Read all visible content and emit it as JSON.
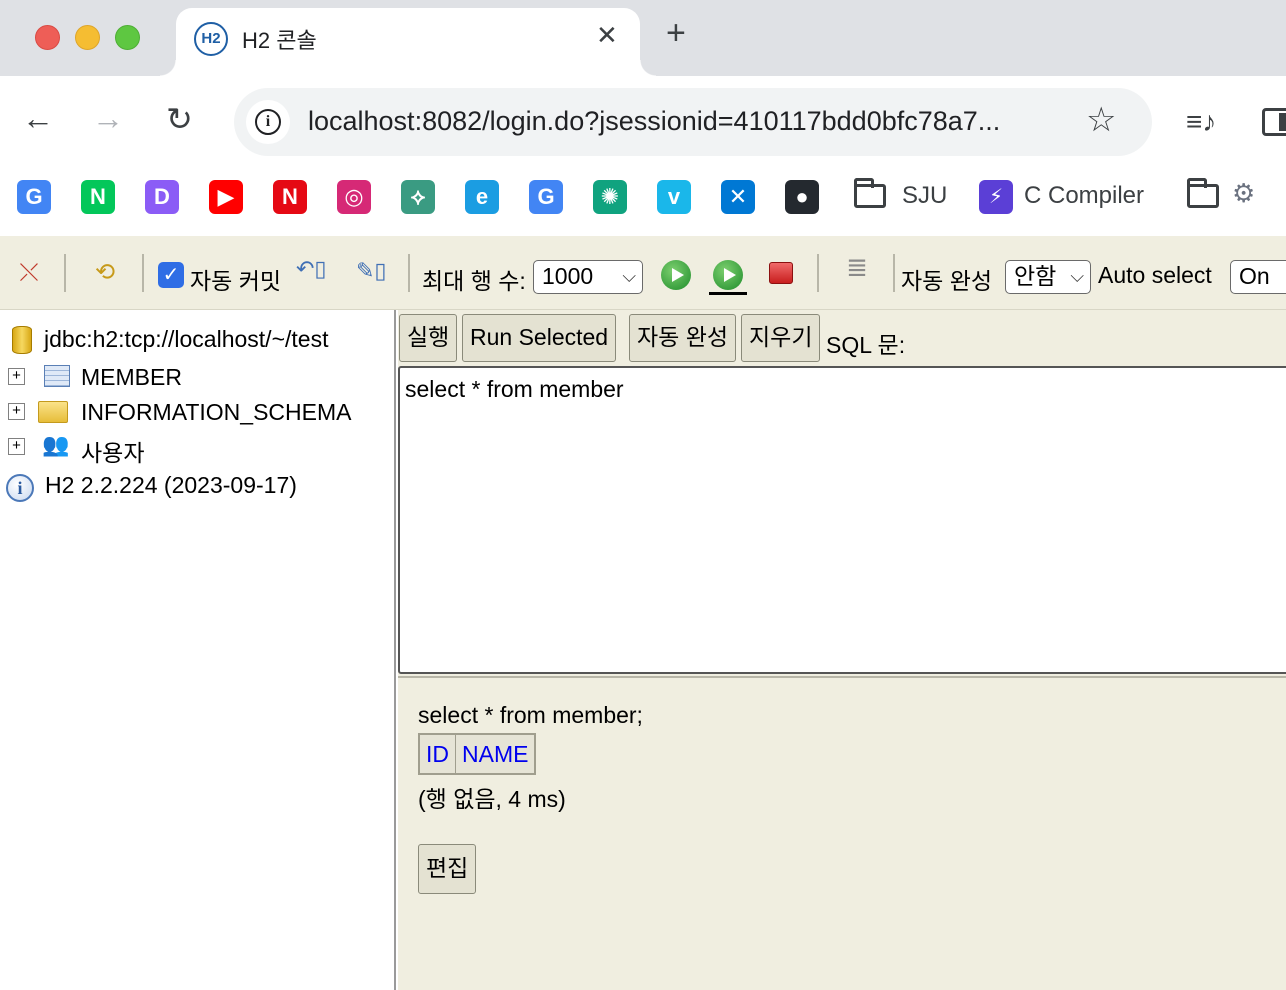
{
  "browser": {
    "tab": {
      "favicon_text": "H2",
      "title": "H2 콘솔"
    },
    "url": "localhost:8082/login.do?jsessionid=410117bdd0bfc78a7...",
    "bookmarks": [
      {
        "name": "google-bookmark",
        "glyph": "G",
        "color": "#4285f4"
      },
      {
        "name": "naver-bookmark",
        "glyph": "N",
        "color": "#03c75a"
      },
      {
        "name": "d-bookmark",
        "glyph": "D",
        "color": "#8b5cf6"
      },
      {
        "name": "youtube-bookmark",
        "glyph": "▶",
        "color": "#ff0000"
      },
      {
        "name": "netflix-bookmark",
        "glyph": "N",
        "color": "#e50914"
      },
      {
        "name": "instagram-bookmark",
        "glyph": "◎",
        "color": "#d62976"
      },
      {
        "name": "git-graph-bookmark",
        "glyph": "⟡",
        "color": "#3a9b82"
      },
      {
        "name": "edge-bookmark",
        "glyph": "e",
        "color": "#1b9de2"
      },
      {
        "name": "google-bookmark-2",
        "glyph": "G",
        "color": "#4285f4"
      },
      {
        "name": "chatgpt-bookmark",
        "glyph": "✺",
        "color": "#10a37f"
      },
      {
        "name": "vimeo-bookmark",
        "glyph": "v",
        "color": "#1ab7ea"
      },
      {
        "name": "vscode-bookmark",
        "glyph": "✕",
        "color": "#0078d4"
      },
      {
        "name": "github-bookmark",
        "glyph": "●",
        "color": "#24292f"
      }
    ],
    "bookmark_folders": {
      "sju": "SJU",
      "c_compiler": "C Compiler"
    }
  },
  "toolbar": {
    "autocommit_label": "자동 커밋",
    "max_rows_label": "최대 행 수:",
    "max_rows_value": "1000",
    "autocomplete_label": "자동 완성",
    "autocomplete_value": "안함",
    "autoselect_label": "Auto select",
    "autoselect_value": "On"
  },
  "tree": {
    "connection": "jdbc:h2:tcp://localhost/~/test",
    "items": [
      "MEMBER",
      "INFORMATION_SCHEMA",
      "사용자"
    ],
    "version": "H2 2.2.224 (2023-09-17)"
  },
  "editor": {
    "buttons": {
      "run": "실행",
      "run_selected": "Run Selected",
      "autocomplete": "자동 완성",
      "clear": "지우기"
    },
    "sql_label": "SQL 문:",
    "sql": "select * from member"
  },
  "result": {
    "sql": "select * from member;",
    "columns": [
      "ID",
      "NAME"
    ],
    "meta": "(행 없음, 4 ms)",
    "edit_button": "편집"
  }
}
